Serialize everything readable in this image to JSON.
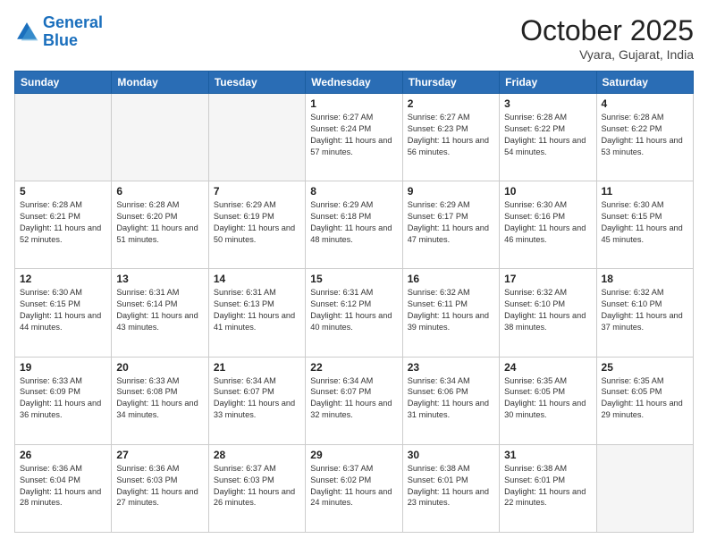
{
  "header": {
    "logo_line1": "General",
    "logo_line2": "Blue",
    "title": "October 2025",
    "subtitle": "Vyara, Gujarat, India"
  },
  "weekdays": [
    "Sunday",
    "Monday",
    "Tuesday",
    "Wednesday",
    "Thursday",
    "Friday",
    "Saturday"
  ],
  "weeks": [
    [
      {
        "day": "",
        "info": ""
      },
      {
        "day": "",
        "info": ""
      },
      {
        "day": "",
        "info": ""
      },
      {
        "day": "1",
        "info": "Sunrise: 6:27 AM\nSunset: 6:24 PM\nDaylight: 11 hours and 57 minutes."
      },
      {
        "day": "2",
        "info": "Sunrise: 6:27 AM\nSunset: 6:23 PM\nDaylight: 11 hours and 56 minutes."
      },
      {
        "day": "3",
        "info": "Sunrise: 6:28 AM\nSunset: 6:22 PM\nDaylight: 11 hours and 54 minutes."
      },
      {
        "day": "4",
        "info": "Sunrise: 6:28 AM\nSunset: 6:22 PM\nDaylight: 11 hours and 53 minutes."
      }
    ],
    [
      {
        "day": "5",
        "info": "Sunrise: 6:28 AM\nSunset: 6:21 PM\nDaylight: 11 hours and 52 minutes."
      },
      {
        "day": "6",
        "info": "Sunrise: 6:28 AM\nSunset: 6:20 PM\nDaylight: 11 hours and 51 minutes."
      },
      {
        "day": "7",
        "info": "Sunrise: 6:29 AM\nSunset: 6:19 PM\nDaylight: 11 hours and 50 minutes."
      },
      {
        "day": "8",
        "info": "Sunrise: 6:29 AM\nSunset: 6:18 PM\nDaylight: 11 hours and 48 minutes."
      },
      {
        "day": "9",
        "info": "Sunrise: 6:29 AM\nSunset: 6:17 PM\nDaylight: 11 hours and 47 minutes."
      },
      {
        "day": "10",
        "info": "Sunrise: 6:30 AM\nSunset: 6:16 PM\nDaylight: 11 hours and 46 minutes."
      },
      {
        "day": "11",
        "info": "Sunrise: 6:30 AM\nSunset: 6:15 PM\nDaylight: 11 hours and 45 minutes."
      }
    ],
    [
      {
        "day": "12",
        "info": "Sunrise: 6:30 AM\nSunset: 6:15 PM\nDaylight: 11 hours and 44 minutes."
      },
      {
        "day": "13",
        "info": "Sunrise: 6:31 AM\nSunset: 6:14 PM\nDaylight: 11 hours and 43 minutes."
      },
      {
        "day": "14",
        "info": "Sunrise: 6:31 AM\nSunset: 6:13 PM\nDaylight: 11 hours and 41 minutes."
      },
      {
        "day": "15",
        "info": "Sunrise: 6:31 AM\nSunset: 6:12 PM\nDaylight: 11 hours and 40 minutes."
      },
      {
        "day": "16",
        "info": "Sunrise: 6:32 AM\nSunset: 6:11 PM\nDaylight: 11 hours and 39 minutes."
      },
      {
        "day": "17",
        "info": "Sunrise: 6:32 AM\nSunset: 6:10 PM\nDaylight: 11 hours and 38 minutes."
      },
      {
        "day": "18",
        "info": "Sunrise: 6:32 AM\nSunset: 6:10 PM\nDaylight: 11 hours and 37 minutes."
      }
    ],
    [
      {
        "day": "19",
        "info": "Sunrise: 6:33 AM\nSunset: 6:09 PM\nDaylight: 11 hours and 36 minutes."
      },
      {
        "day": "20",
        "info": "Sunrise: 6:33 AM\nSunset: 6:08 PM\nDaylight: 11 hours and 34 minutes."
      },
      {
        "day": "21",
        "info": "Sunrise: 6:34 AM\nSunset: 6:07 PM\nDaylight: 11 hours and 33 minutes."
      },
      {
        "day": "22",
        "info": "Sunrise: 6:34 AM\nSunset: 6:07 PM\nDaylight: 11 hours and 32 minutes."
      },
      {
        "day": "23",
        "info": "Sunrise: 6:34 AM\nSunset: 6:06 PM\nDaylight: 11 hours and 31 minutes."
      },
      {
        "day": "24",
        "info": "Sunrise: 6:35 AM\nSunset: 6:05 PM\nDaylight: 11 hours and 30 minutes."
      },
      {
        "day": "25",
        "info": "Sunrise: 6:35 AM\nSunset: 6:05 PM\nDaylight: 11 hours and 29 minutes."
      }
    ],
    [
      {
        "day": "26",
        "info": "Sunrise: 6:36 AM\nSunset: 6:04 PM\nDaylight: 11 hours and 28 minutes."
      },
      {
        "day": "27",
        "info": "Sunrise: 6:36 AM\nSunset: 6:03 PM\nDaylight: 11 hours and 27 minutes."
      },
      {
        "day": "28",
        "info": "Sunrise: 6:37 AM\nSunset: 6:03 PM\nDaylight: 11 hours and 26 minutes."
      },
      {
        "day": "29",
        "info": "Sunrise: 6:37 AM\nSunset: 6:02 PM\nDaylight: 11 hours and 24 minutes."
      },
      {
        "day": "30",
        "info": "Sunrise: 6:38 AM\nSunset: 6:01 PM\nDaylight: 11 hours and 23 minutes."
      },
      {
        "day": "31",
        "info": "Sunrise: 6:38 AM\nSunset: 6:01 PM\nDaylight: 11 hours and 22 minutes."
      },
      {
        "day": "",
        "info": ""
      }
    ]
  ]
}
